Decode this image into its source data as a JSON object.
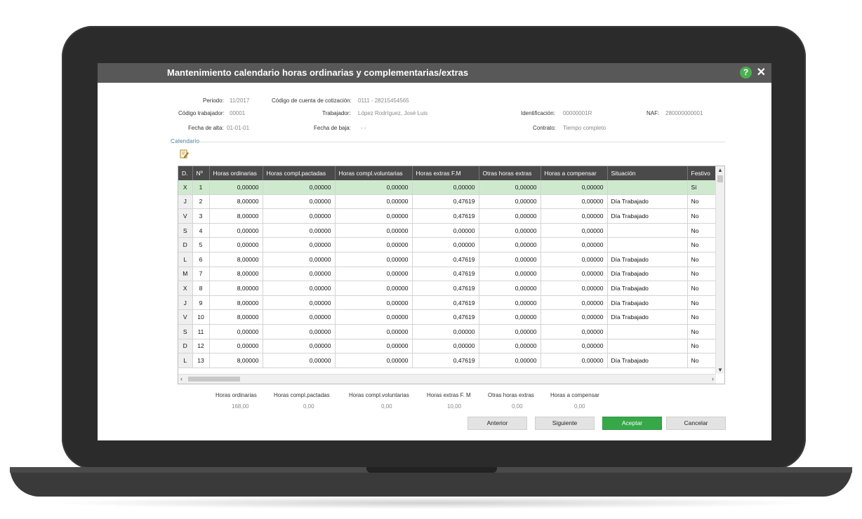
{
  "window": {
    "title": "Mantenimiento calendario horas ordinarias y complementarias/extras",
    "help_icon": "?",
    "close_icon": "✕"
  },
  "header": {
    "periodo_label": "Periodo:",
    "periodo_value": "11/2017",
    "codigo_cuenta_label": "Código de cuenta de cotización:",
    "codigo_cuenta_value": "0111 - 28215454565",
    "codigo_trabajador_label": "Código trabajador:",
    "codigo_trabajador_value": "00001",
    "trabajador_label": "Trabajador:",
    "trabajador_value": "López Rodríguez, José Luis",
    "identificacion_label": "Identificación:",
    "identificacion_value": "00000001R",
    "naf_label": "NAF:",
    "naf_value": "280000000001",
    "fecha_alta_label": "Fecha de alta:",
    "fecha_alta_value": "01-01-01",
    "fecha_baja_label": "Fecha de baja:",
    "fecha_baja_value": "- -",
    "contrato_label": "Contrato:",
    "contrato_value": "Tiempo completo"
  },
  "calendar": {
    "section_label": "Calendario",
    "columns": [
      "D.",
      "Nº",
      "Horas ordinarias",
      "Horas compl.pactadas",
      "Horas compl.voluntarias",
      "Horas extras F.M",
      "Otras horas extras",
      "Horas a compensar",
      "Situación",
      "Festivo"
    ],
    "rows": [
      {
        "d": "X",
        "n": "1",
        "ord": "0,00000",
        "pact": "0,00000",
        "vol": "0,00000",
        "extra": "0,00000",
        "otras": "0,00000",
        "comp": "0,00000",
        "sit": "",
        "fest": "Sí"
      },
      {
        "d": "J",
        "n": "2",
        "ord": "8,00000",
        "pact": "0,00000",
        "vol": "0,00000",
        "extra": "0,47619",
        "otras": "0,00000",
        "comp": "0,00000",
        "sit": "Día Trabajado",
        "fest": "No"
      },
      {
        "d": "V",
        "n": "3",
        "ord": "8,00000",
        "pact": "0,00000",
        "vol": "0,00000",
        "extra": "0,47619",
        "otras": "0,00000",
        "comp": "0,00000",
        "sit": "Día Trabajado",
        "fest": "No"
      },
      {
        "d": "S",
        "n": "4",
        "ord": "0,00000",
        "pact": "0,00000",
        "vol": "0,00000",
        "extra": "0,00000",
        "otras": "0,00000",
        "comp": "0,00000",
        "sit": "",
        "fest": "No"
      },
      {
        "d": "D",
        "n": "5",
        "ord": "0,00000",
        "pact": "0,00000",
        "vol": "0,00000",
        "extra": "0,00000",
        "otras": "0,00000",
        "comp": "0,00000",
        "sit": "",
        "fest": "No"
      },
      {
        "d": "L",
        "n": "6",
        "ord": "8,00000",
        "pact": "0,00000",
        "vol": "0,00000",
        "extra": "0,47619",
        "otras": "0,00000",
        "comp": "0,00000",
        "sit": "Día Trabajado",
        "fest": "No"
      },
      {
        "d": "M",
        "n": "7",
        "ord": "8,00000",
        "pact": "0,00000",
        "vol": "0,00000",
        "extra": "0,47619",
        "otras": "0,00000",
        "comp": "0,00000",
        "sit": "Día Trabajado",
        "fest": "No"
      },
      {
        "d": "X",
        "n": "8",
        "ord": "8,00000",
        "pact": "0,00000",
        "vol": "0,00000",
        "extra": "0,47619",
        "otras": "0,00000",
        "comp": "0,00000",
        "sit": "Día Trabajado",
        "fest": "No"
      },
      {
        "d": "J",
        "n": "9",
        "ord": "8,00000",
        "pact": "0,00000",
        "vol": "0,00000",
        "extra": "0,47619",
        "otras": "0,00000",
        "comp": "0,00000",
        "sit": "Día Trabajado",
        "fest": "No"
      },
      {
        "d": "V",
        "n": "10",
        "ord": "8,00000",
        "pact": "0,00000",
        "vol": "0,00000",
        "extra": "0,47619",
        "otras": "0,00000",
        "comp": "0,00000",
        "sit": "Día Trabajado",
        "fest": "No"
      },
      {
        "d": "S",
        "n": "11",
        "ord": "0,00000",
        "pact": "0,00000",
        "vol": "0,00000",
        "extra": "0,00000",
        "otras": "0,00000",
        "comp": "0,00000",
        "sit": "",
        "fest": "No"
      },
      {
        "d": "D",
        "n": "12",
        "ord": "0,00000",
        "pact": "0,00000",
        "vol": "0,00000",
        "extra": "0,00000",
        "otras": "0,00000",
        "comp": "0,00000",
        "sit": "",
        "fest": "No"
      },
      {
        "d": "L",
        "n": "13",
        "ord": "8,00000",
        "pact": "0,00000",
        "vol": "0,00000",
        "extra": "0,47619",
        "otras": "0,00000",
        "comp": "0,00000",
        "sit": "Día Trabajado",
        "fest": "No"
      }
    ],
    "selected_row": 0
  },
  "totals": [
    {
      "label": "Horas ordinarias",
      "value": "168,00"
    },
    {
      "label": "Horas compl.pactadas",
      "value": "0,00"
    },
    {
      "label": "Horas compl.voluntarias",
      "value": "0,00"
    },
    {
      "label": "Horas extras F. M",
      "value": "10,00"
    },
    {
      "label": "Otras horas extras",
      "value": "0,00"
    },
    {
      "label": "Horas a compensar",
      "value": "0,00"
    }
  ],
  "buttons": {
    "anterior": "Anterior",
    "siguiente": "Siguiente",
    "aceptar": "Aceptar",
    "cancelar": "Cancelar"
  },
  "colors": {
    "titlebar": "#585858",
    "accent_green": "#37a84a",
    "selected_row": "#cfe9cf",
    "grid_header": "#4a4a4a"
  }
}
